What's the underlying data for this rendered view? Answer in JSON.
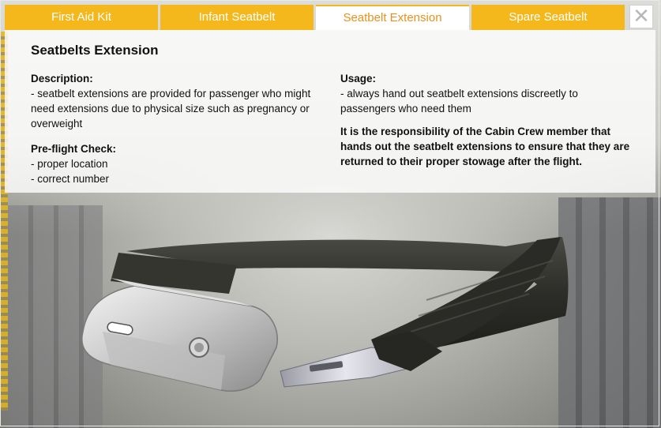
{
  "tabs": [
    {
      "label": "First Aid Kit",
      "active": false
    },
    {
      "label": "Infant Seatbelt",
      "active": false
    },
    {
      "label": "Seatbelt Extension",
      "active": true
    },
    {
      "label": "Spare Seatbelt",
      "active": false
    }
  ],
  "close_icon": "close-icon",
  "content": {
    "title": "Seatbelts Extension",
    "description_label": "Description:",
    "description_text": "- seatbelt extensions are provided for passenger who might need extensions due to physical size such as pregnancy or overweight",
    "preflight_label": "Pre-flight Check:",
    "preflight_items": [
      "- proper location",
      "- correct number"
    ],
    "usage_label": "Usage:",
    "usage_text": "- always hand out seatbelt extensions discreetly to passengers who need them",
    "responsibility_note": "It is the responsibility of the Cabin Crew member that hands out the seatbelt extensions to ensure that they are returned to their proper stowage after the flight."
  },
  "colors": {
    "tab_bg": "#f5b81c",
    "tab_text": "#ffffff",
    "active_tab_text": "#e8921b",
    "panel_bg": "#ffffff"
  }
}
